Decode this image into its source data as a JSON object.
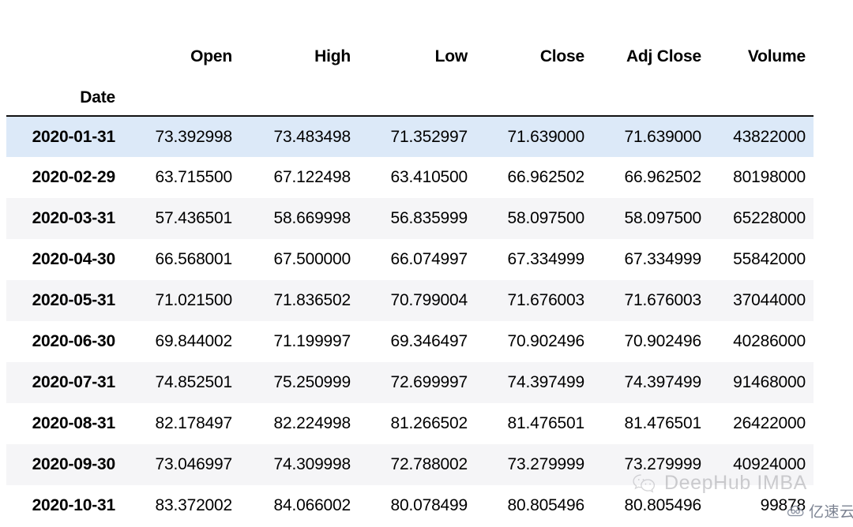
{
  "table": {
    "index_name": "Date",
    "columns": [
      "Open",
      "High",
      "Low",
      "Close",
      "Adj Close",
      "Volume"
    ],
    "rows": [
      {
        "date": "2020-01-31",
        "cells": [
          "73.392998",
          "73.483498",
          "71.352997",
          "71.639000",
          "71.639000",
          "43822000"
        ],
        "selected": true,
        "stripe": false
      },
      {
        "date": "2020-02-29",
        "cells": [
          "63.715500",
          "67.122498",
          "63.410500",
          "66.962502",
          "66.962502",
          "80198000"
        ],
        "selected": false,
        "stripe": false
      },
      {
        "date": "2020-03-31",
        "cells": [
          "57.436501",
          "58.669998",
          "56.835999",
          "58.097500",
          "58.097500",
          "65228000"
        ],
        "selected": false,
        "stripe": true
      },
      {
        "date": "2020-04-30",
        "cells": [
          "66.568001",
          "67.500000",
          "66.074997",
          "67.334999",
          "67.334999",
          "55842000"
        ],
        "selected": false,
        "stripe": false
      },
      {
        "date": "2020-05-31",
        "cells": [
          "71.021500",
          "71.836502",
          "70.799004",
          "71.676003",
          "71.676003",
          "37044000"
        ],
        "selected": false,
        "stripe": true
      },
      {
        "date": "2020-06-30",
        "cells": [
          "69.844002",
          "71.199997",
          "69.346497",
          "70.902496",
          "70.902496",
          "40286000"
        ],
        "selected": false,
        "stripe": false
      },
      {
        "date": "2020-07-31",
        "cells": [
          "74.852501",
          "75.250999",
          "72.699997",
          "74.397499",
          "74.397499",
          "91468000"
        ],
        "selected": false,
        "stripe": true
      },
      {
        "date": "2020-08-31",
        "cells": [
          "82.178497",
          "82.224998",
          "81.266502",
          "81.476501",
          "81.476501",
          "26422000"
        ],
        "selected": false,
        "stripe": false
      },
      {
        "date": "2020-09-30",
        "cells": [
          "73.046997",
          "74.309998",
          "72.788002",
          "73.279999",
          "73.279999",
          "40924000"
        ],
        "selected": false,
        "stripe": true
      },
      {
        "date": "2020-10-31",
        "cells": [
          "83.372002",
          "84.066002",
          "80.078499",
          "80.805496",
          "80.805496",
          "99878"
        ],
        "selected": false,
        "stripe": false
      }
    ]
  },
  "watermarks": {
    "deephub": "DeepHub IMBA",
    "yisuyun": "亿速云"
  },
  "colors": {
    "selected_row": "#dce9f8",
    "stripe_row": "#f5f5f7",
    "header_rule": "#111111",
    "text": "#000000",
    "watermark_gray": "#8d8d93"
  }
}
